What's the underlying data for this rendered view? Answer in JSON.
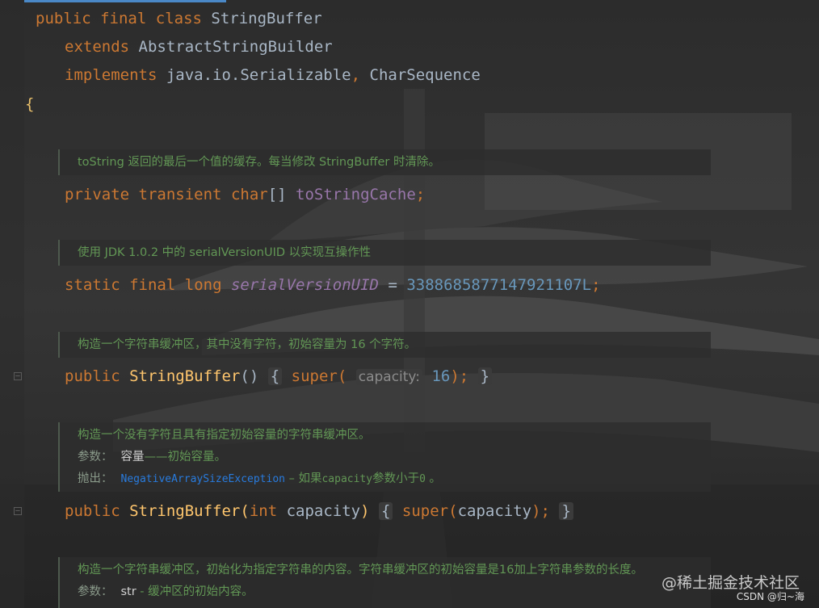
{
  "class_decl": {
    "kw_public": "public",
    "kw_final": "final",
    "kw_class": "class",
    "name": "StringBuffer",
    "kw_extends": "extends",
    "superclass": "AbstractStringBuilder",
    "kw_implements": "implements",
    "iface1": "java.io.Serializable",
    "comma": ",",
    "iface2": "CharSequence",
    "open_brace": "{"
  },
  "docs": [
    {
      "text": "toString 返回的最后一个值的缓存。每当修改 StringBuffer 时清除。"
    },
    {
      "text": "使用 JDK 1.0.2 中的 serialVersionUID 以实现互操作性"
    },
    {
      "text": "构造一个字符串缓冲区，其中没有字符，初始容量为 16 个字符。"
    },
    {
      "text": "构造一个没有字符且具有指定初始容量的字符串缓冲区。",
      "param_label": "参数：",
      "param_name": "容量",
      "param_desc": "——初始容量。",
      "throws_label": "抛出：",
      "throws_type": "NegativeArraySizeException",
      "throws_dash": " – 如果",
      "throws_code": "capacity",
      "throws_mid": "参数小于",
      "throws_zero": "0",
      "throws_end": " 。"
    },
    {
      "text": "构造一个字符串缓冲区，初始化为指定字符串的内容。字符串缓冲区的初始容量是16加上字符串参数的长度。",
      "param_label": "参数：",
      "param_name": "str",
      "param_desc": " - 缓冲区的初始内容。"
    }
  ],
  "fields": {
    "cache": {
      "kw_private": "private",
      "kw_transient": "transient",
      "type": "char",
      "brackets": "[]",
      "name": "toStringCache",
      "semi": ";"
    },
    "serial": {
      "kw_static": "static",
      "kw_final": "final",
      "kw_long": "long",
      "name": "serialVersionUID",
      "eq": " = ",
      "value": "3388685877147921107L",
      "semi": ";"
    }
  },
  "ctors": {
    "c1": {
      "kw_public": "public",
      "name": "StringBuffer",
      "parens": "()",
      "open": "{",
      "kw_super": "super(",
      "hint": "capacity:",
      "arg": "16",
      "close_call": ");",
      "close": "}"
    },
    "c2": {
      "kw_public": "public",
      "name": "StringBuffer",
      "lparen": "(",
      "kw_int": "int",
      "param": " capacity",
      "rparen": ")",
      "open": "{",
      "kw_super": "super",
      "call_open": "(",
      "call_arg": "capacity",
      "call_close": ")",
      "semi": ";",
      "close": "}"
    }
  },
  "watermark": {
    "main": "@稀土掘金技术社区",
    "sub": "CSDN @归~海"
  }
}
